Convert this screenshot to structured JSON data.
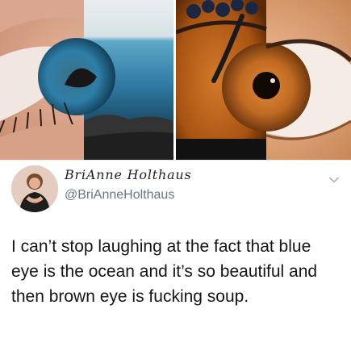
{
  "tweet": {
    "author_name": "BriAnne Holthaus",
    "author_handle": "@BriAnneHolthaus",
    "text": "I can’t stop laughing at the fact that blue eye is the ocean and it’s so beautiful and then brown eye is fucking soup."
  },
  "icons": {
    "menu": "chevron-down-icon"
  },
  "colors": {
    "handle": "#657786",
    "text": "#14171a",
    "ocean": "#3f8fb5",
    "soup": "#b8621e"
  }
}
